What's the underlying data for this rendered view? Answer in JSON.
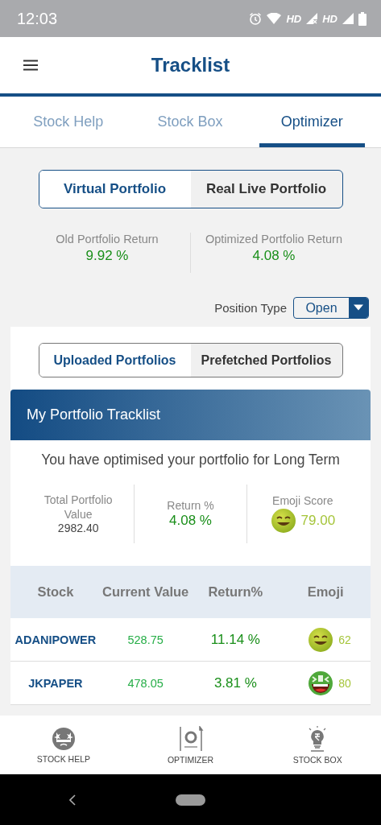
{
  "status_bar": {
    "time": "12:03",
    "network_labels": [
      "HD",
      "HD"
    ]
  },
  "app_bar": {
    "title": "Tracklist"
  },
  "tabs": [
    {
      "label": "Stock Help",
      "selected": false
    },
    {
      "label": "Stock Box",
      "selected": false
    },
    {
      "label": "Optimizer",
      "selected": true
    }
  ],
  "portfolio_toggle": [
    {
      "label": "Virtual Portfolio",
      "selected": true
    },
    {
      "label": "Real Live Portfolio",
      "selected": false
    }
  ],
  "returns": [
    {
      "label": "Old Portfolio Return",
      "value": "9.92 %"
    },
    {
      "label": "Optimized Portfolio Return",
      "value": "4.08 %"
    }
  ],
  "position_type": {
    "label": "Position Type",
    "value": "Open"
  },
  "source_toggle": [
    {
      "label": "Uploaded Portfolios",
      "selected": true
    },
    {
      "label": "Prefetched Portfolios",
      "selected": false
    }
  ],
  "tracklist_card": {
    "title": "My Portfolio Tracklist",
    "subtitle": "You have optimised your portfolio for Long Term",
    "stats": [
      {
        "kind": "value",
        "label": "Total Portfolio Value",
        "value": "2982.40"
      },
      {
        "kind": "return",
        "label": "Return %",
        "value": "4.08 %"
      },
      {
        "kind": "emoji",
        "label": "Emoji Score",
        "value": "79.00",
        "emoji": {
          "kind": "smile"
        }
      }
    ]
  },
  "table": {
    "columns": [
      "Stock",
      "Current Value",
      "Return%",
      "Emoji"
    ],
    "rows": [
      {
        "stock": "ADANIPOWER",
        "current_value": "528.75",
        "return": "11.14 %",
        "emoji": {
          "kind": "smile"
        },
        "emoji_score": "62"
      },
      {
        "stock": "JKPAPER",
        "current_value": "478.05",
        "return": "3.81 %",
        "emoji": {
          "kind": "grin"
        },
        "emoji_score": "80"
      }
    ]
  },
  "bottom_nav": [
    {
      "kind": "face",
      "label": "STOCK HELP"
    },
    {
      "kind": "optimizer",
      "label": "OPTIMIZER"
    },
    {
      "kind": "bulb",
      "label": "STOCK BOX"
    }
  ]
}
